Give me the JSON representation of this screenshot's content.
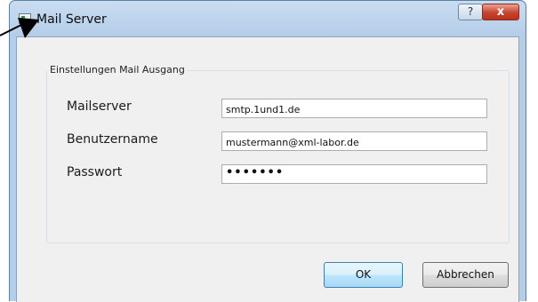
{
  "window": {
    "title": "Mail Server"
  },
  "titlebar": {
    "help_glyph": "?",
    "close_glyph": "x"
  },
  "group": {
    "legend": "Einstellungen Mail Ausgang",
    "fields": [
      {
        "label": "Mailserver",
        "value": "smtp.1und1.de"
      },
      {
        "label": "Benutzername",
        "value": "mustermann@xml-labor.de"
      },
      {
        "label": "Passwort",
        "value": "•••••••"
      }
    ]
  },
  "buttons": {
    "ok": "OK",
    "cancel": "Abbrechen"
  },
  "icons": {
    "app": "window-app-icon",
    "pointer": "arrow-pointer-icon"
  }
}
